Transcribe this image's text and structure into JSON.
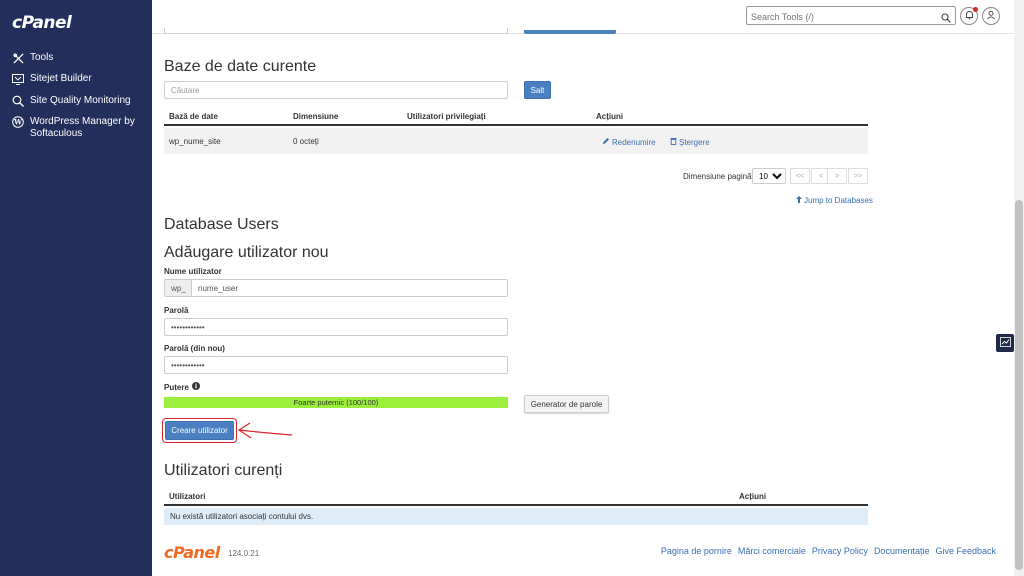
{
  "sidebar": {
    "logo": "cPanel",
    "items": [
      {
        "label": "Tools"
      },
      {
        "label": "Sitejet Builder"
      },
      {
        "label": "Site Quality Monitoring"
      },
      {
        "label": "WordPress Manager by Softaculous"
      }
    ]
  },
  "header": {
    "search_placeholder": "Search Tools (/)"
  },
  "databases": {
    "title": "Baze de date curente",
    "search_placeholder": "Căutare",
    "go_button": "Salt",
    "columns": [
      "Bază de date",
      "Dimensiune",
      "Utilizatori privilegiați",
      "Acțiuni"
    ],
    "rows": [
      {
        "name": "wp_nume_site",
        "size": "0 octeți",
        "users": "",
        "rename": "Redenumire",
        "delete": "Ștergere"
      }
    ],
    "page_size_label": "Dimensiune pagină",
    "page_size_value": "10",
    "pager": [
      "<<",
      "<",
      ">",
      ">>"
    ],
    "jump_link": "Jump to Databases"
  },
  "users": {
    "section_title": "Database Users",
    "add_title": "Adăugare utilizator nou",
    "username_label": "Nume utilizator",
    "prefix": "wp_",
    "username_value": "nume_user",
    "password_label": "Parolă",
    "password_value": "••••••••••••",
    "password_again_label": "Parolă (din nou)",
    "password_again_value": "••••••••••••",
    "strength_label": "Putere",
    "strength_text": "Foarte puternic (100/100)",
    "strength_fraction": 1.0,
    "generator_button": "Generator de parole",
    "create_button": "Creare utilizator"
  },
  "current_users": {
    "title": "Utilizatori curenți",
    "columns": [
      "Utilizatori",
      "Acțiuni"
    ],
    "empty_text": "Nu există utilizatori asociați contului dvs."
  },
  "footer": {
    "logo": "cPanel",
    "version": "124.0.21",
    "links": [
      "Pagina de pornire",
      "Mărci comerciale",
      "Privacy Policy",
      "Documentație",
      "Give Feedback"
    ]
  },
  "colors": {
    "sidebar_bg": "#232f5b",
    "primary": "#4a7fc1",
    "link": "#3a6fb0",
    "strength": "#9bee3b",
    "highlight": "#d9262c",
    "brand_orange": "#f26a21"
  }
}
